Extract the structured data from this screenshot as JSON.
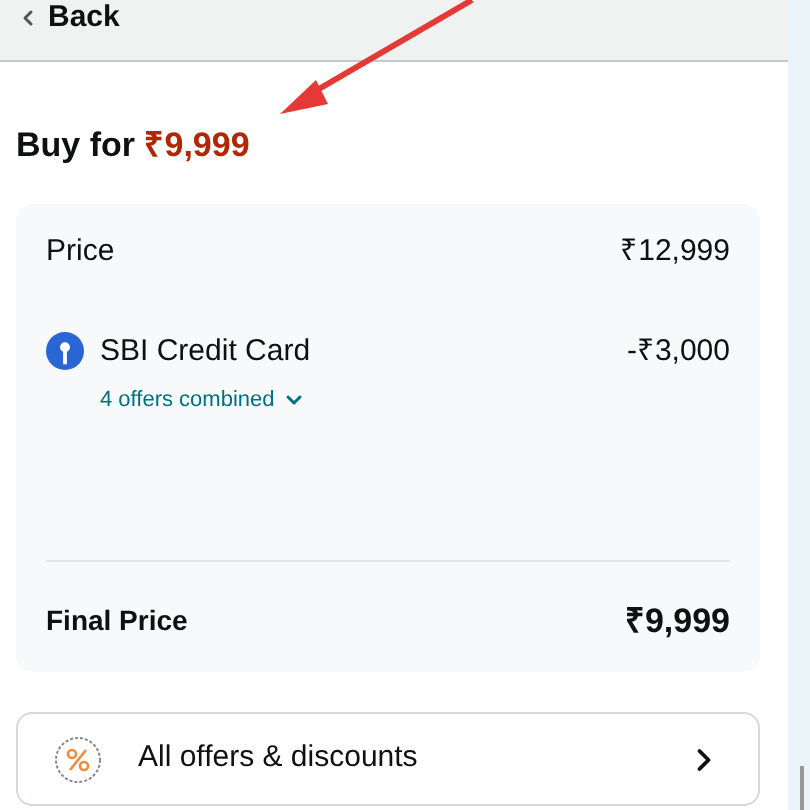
{
  "header": {
    "back_label": "Back"
  },
  "buy": {
    "label": "Buy for",
    "price": "₹9,999"
  },
  "summary": {
    "rows": [
      {
        "kind": "plain",
        "label": "Price",
        "value": "₹12,999"
      },
      {
        "kind": "offer",
        "label": "SBI Credit Card",
        "value": "-₹3,000",
        "detail": "4 offers combined",
        "expanded": false
      }
    ],
    "total": {
      "label": "Final Price",
      "value": "₹9,999"
    }
  },
  "offers_link": {
    "label": "All offers & discounts"
  }
}
